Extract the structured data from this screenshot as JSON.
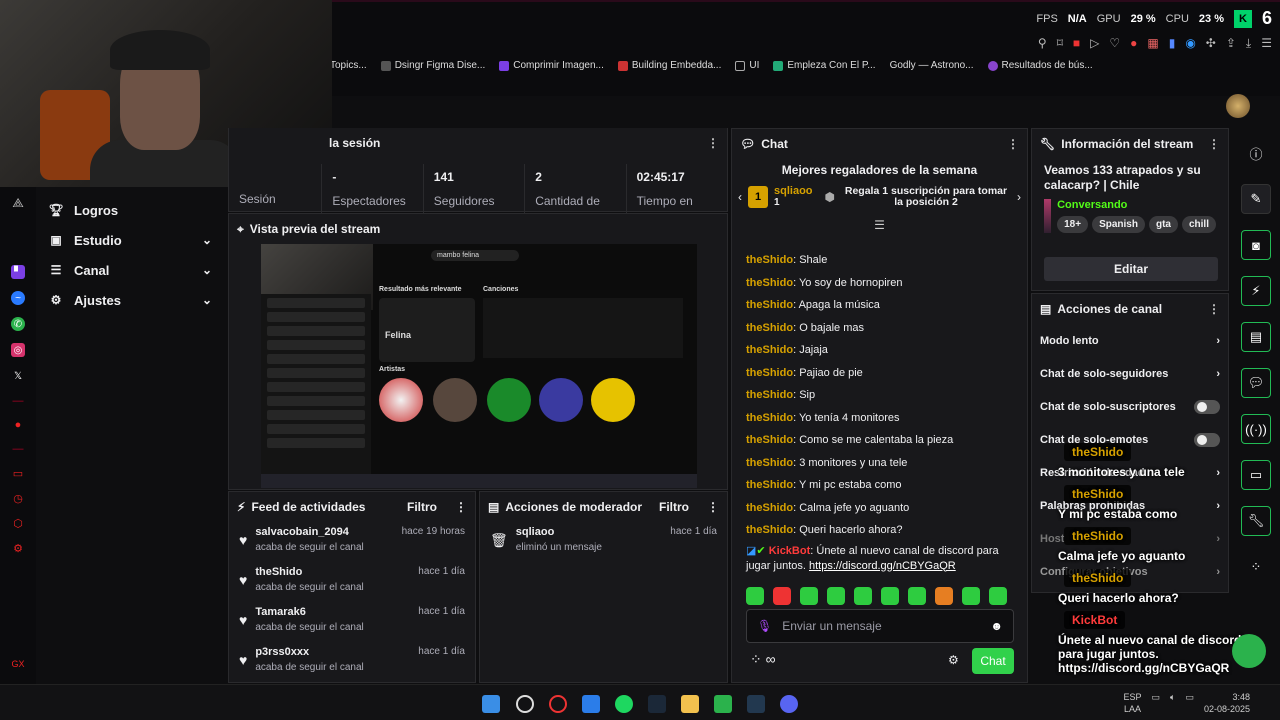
{
  "hud": {
    "fps_label": "FPS",
    "fps_value": "N/A",
    "gpu_label": "GPU",
    "gpu_value": "29 %",
    "cpu_label": "CPU",
    "cpu_value": "23 %",
    "badge": "6"
  },
  "bookmarks": [
    {
      "label": "Topics..."
    },
    {
      "label": "Dsingr Figma Dise..."
    },
    {
      "label": "Comprimir Imagen..."
    },
    {
      "label": "Building Embedda..."
    },
    {
      "label": "UI"
    },
    {
      "label": "Empleza Con El P..."
    },
    {
      "label": "Godly — Astrono..."
    },
    {
      "label": "Resultados de bús..."
    }
  ],
  "sidenav": {
    "items": [
      {
        "label": "Logros",
        "icon": "trophy-icon"
      },
      {
        "label": "Estudio",
        "icon": "camera-icon"
      },
      {
        "label": "Canal",
        "icon": "list-icon"
      },
      {
        "label": "Ajustes",
        "icon": "gear-icon"
      }
    ]
  },
  "stats": {
    "title_fragment": "la sesión",
    "session_label": "Sesión",
    "items": [
      {
        "value": "-",
        "label": "Espectadores"
      },
      {
        "value": "141",
        "label": "Seguidores"
      },
      {
        "value": "2",
        "label": "Cantidad de"
      },
      {
        "value": "02:45:17",
        "label": "Tiempo en"
      }
    ]
  },
  "preview": {
    "title": "Vista previa del stream",
    "search_text": "mambo felina",
    "top_result_label": "Resultado más relevante",
    "songs_label": "Canciones",
    "artists_label": "Artistas",
    "top_result": "Felina"
  },
  "feed": {
    "title": "Feed de actividades",
    "filter": "Filtro",
    "rows": [
      {
        "name": "salvacobain_2094",
        "action": "acaba de seguir el canal",
        "time": "hace 19 horas"
      },
      {
        "name": "theShido",
        "action": "acaba de seguir el canal",
        "time": "hace 1 día"
      },
      {
        "name": "Tamarak6",
        "action": "acaba de seguir el canal",
        "time": "hace 1 día"
      },
      {
        "name": "p3rss0xxx",
        "action": "acaba de seguir el canal",
        "time": "hace 1 día"
      }
    ]
  },
  "mod": {
    "title": "Acciones de moderador",
    "filter": "Filtro",
    "rows": [
      {
        "name": "sqliaoo",
        "action": "eliminó un mensaje",
        "time": "hace 1 día"
      }
    ]
  },
  "chat": {
    "title": "Chat",
    "top_gifters": "Mejores regaladores de la semana",
    "gifter_name": "sqliaoo",
    "gifter_rank": "1",
    "gifter_count": "1",
    "gift_cta": "Regala 1 suscripción para tomar la posición 2",
    "messages": [
      {
        "user": "theShido",
        "text": "Shale"
      },
      {
        "user": "theShido",
        "text": "Yo soy de hornopiren"
      },
      {
        "user": "theShido",
        "text": "Apaga la música"
      },
      {
        "user": "theShido",
        "text": "O bajale mas"
      },
      {
        "user": "theShido",
        "text": "Jajaja"
      },
      {
        "user": "theShido",
        "text": "Pajiao de pie"
      },
      {
        "user": "theShido",
        "text": "Sip"
      },
      {
        "user": "theShido",
        "text": "Yo tenía 4 monitores"
      },
      {
        "user": "theShido",
        "text": "Como se me calentaba la pieza"
      },
      {
        "user": "theShido",
        "text": "3 monitores y una tele"
      },
      {
        "user": "theShido",
        "text": "Y mi pc estaba como"
      },
      {
        "user": "theShido",
        "text": "Calma jefe yo aguanto"
      },
      {
        "user": "theShido",
        "text": "Queri hacerlo ahora?"
      }
    ],
    "kickbot_user": "KickBot",
    "kickbot_text": "Únete al nuevo canal de discord para jugar juntos.",
    "kickbot_link": "https://discord.gg/nCBYGaQR",
    "placeholder": "Enviar un mensaje",
    "send": "Chat"
  },
  "info": {
    "title": "Información del stream",
    "stream_title": "Veamos 133 atrapados y su calacarp? | Chile",
    "category": "Conversando",
    "tags": [
      "18+",
      "Spanish",
      "gta",
      "chill"
    ],
    "edit": "Editar"
  },
  "actions": {
    "title": "Acciones de canal",
    "rows": [
      {
        "label": "Modo lento",
        "control": "chevron"
      },
      {
        "label": "Chat de solo-seguidores",
        "control": "chevron"
      },
      {
        "label": "Chat de solo-suscriptores",
        "control": "toggle"
      },
      {
        "label": "Chat de solo-emotes",
        "control": "toggle"
      },
      {
        "label": "Restricción de edad",
        "control": "chevron"
      },
      {
        "label": "Palabras prohibidas",
        "control": "chevron"
      },
      {
        "label": "Host",
        "control": "chevron"
      },
      {
        "label": "Configurar objetivos",
        "control": "chevron"
      }
    ]
  },
  "overlay": {
    "items": [
      {
        "user": "theShido",
        "text": "3 monitores y una tele"
      },
      {
        "user": "theShido",
        "text": "Y mi pc estaba como"
      },
      {
        "user": "theShido",
        "text": "Calma jefe yo aguanto"
      },
      {
        "user": "theShido",
        "text": "Queri hacerlo ahora?"
      }
    ],
    "bot_user": "KickBot",
    "bot_text": "Únete al nuevo canal de discord para jugar juntos.",
    "bot_link": "https://discord.gg/nCBYGaQR"
  },
  "taskbar": {
    "lang": "ESP",
    "lang2": "LAA",
    "time": "3:48",
    "date": "02-08-2025"
  },
  "colors": {
    "accent": "#53fc18",
    "chat_user": "#d6a100",
    "kickbot": "#ff3b3b",
    "send_button": "#31d14b"
  }
}
